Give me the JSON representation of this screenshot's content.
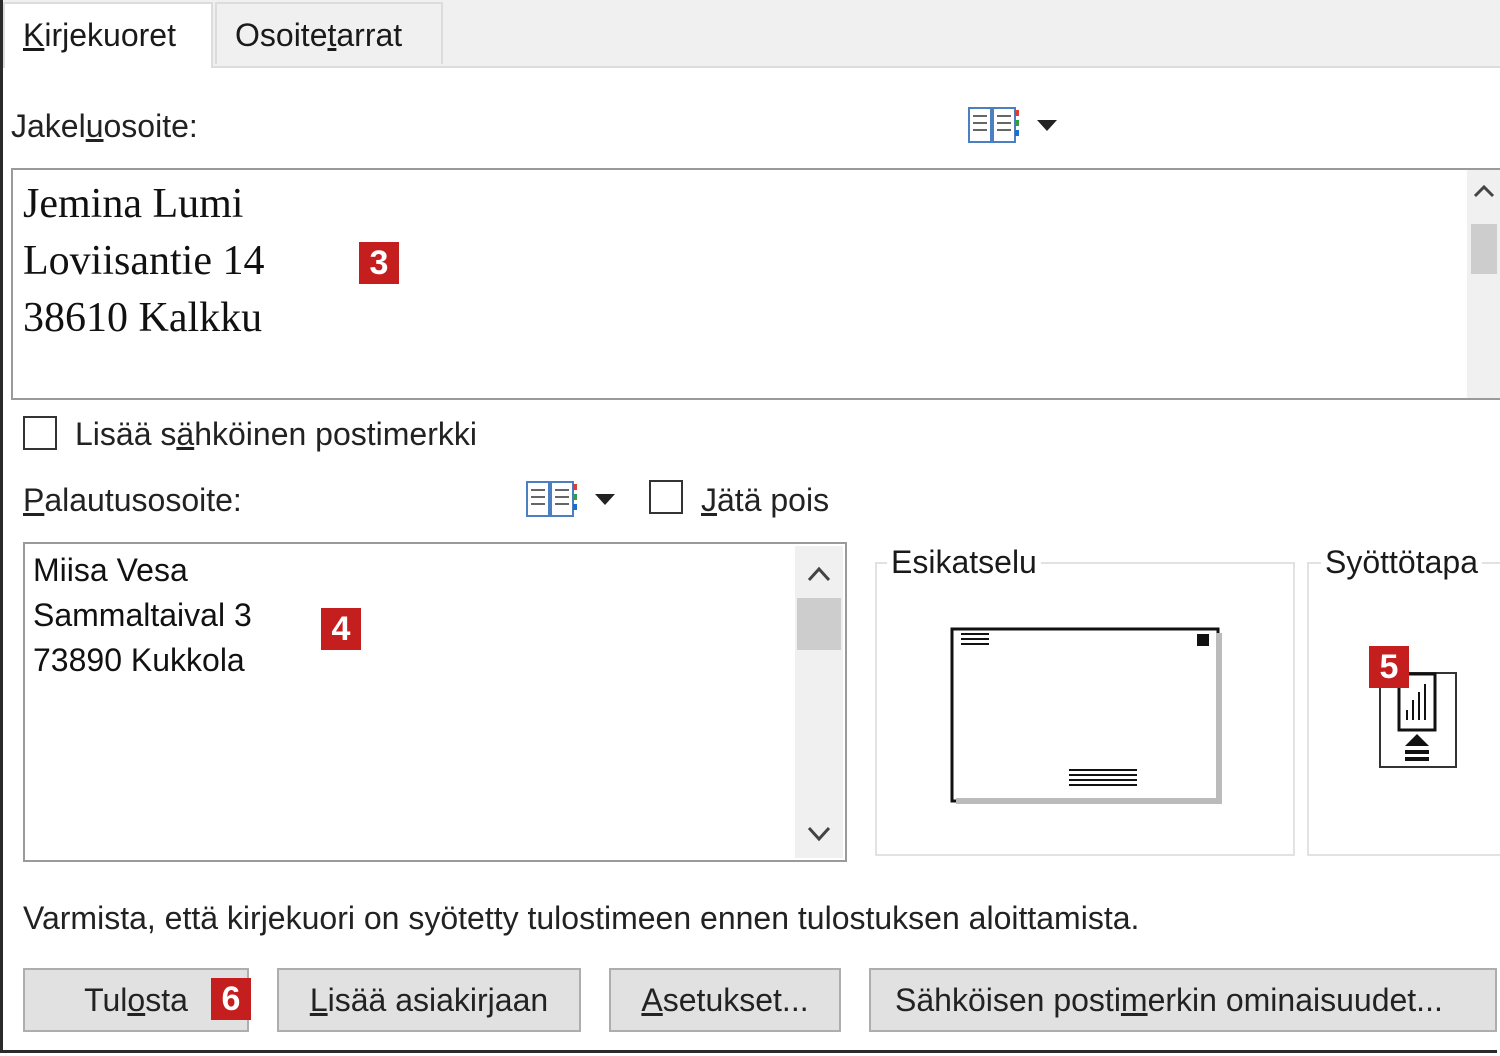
{
  "tabs": [
    {
      "label_pre": "",
      "label_u": "K",
      "label_post": "irjekuoret"
    },
    {
      "label_pre": "Osoite",
      "label_u": "t",
      "label_post": "arrat"
    }
  ],
  "delivery": {
    "label_pre": "Jakel",
    "label_u": "u",
    "label_post": "osoite:",
    "lines": [
      "Jemina Lumi",
      "Loviisantie 14",
      "38610 Kalkku"
    ],
    "badge": "3"
  },
  "epostage": {
    "label_pre": "Lisää s",
    "label_u": "ä",
    "label_post": "hköinen postimerkki"
  },
  "return": {
    "label_pre": "",
    "label_u": "P",
    "label_post": "alautusosoite:",
    "omit_pre": "",
    "omit_u": "J",
    "omit_post": "ätä pois",
    "lines": [
      "Miisa Vesa",
      "Sammaltaival 3",
      "73890 Kukkola"
    ],
    "badge": "4"
  },
  "preview": {
    "title": "Esikatselu"
  },
  "feed": {
    "title": "Syöttötapa",
    "badge": "5"
  },
  "notice": "Varmista, että kirjekuori on syötetty tulostimeen ennen tulostuksen aloittamista.",
  "buttons": {
    "print": {
      "pre": "Tul",
      "u": "o",
      "post": "sta",
      "badge": "6"
    },
    "add": {
      "pre": "",
      "u": "L",
      "post": "isää asiakirjaan"
    },
    "options": {
      "pre": "",
      "u": "A",
      "post": "setukset..."
    },
    "epostage_props": {
      "pre": "Sähköisen posti",
      "u": "m",
      "post": "erkin ominaisuudet..."
    }
  },
  "icons": {
    "address_book": "address-book-icon",
    "dropdown": "dropdown-arrow-icon"
  },
  "colors": {
    "badge": "#c41e1e",
    "button_bg": "#e1e1e1",
    "tabbar": "#f0f0f0"
  }
}
